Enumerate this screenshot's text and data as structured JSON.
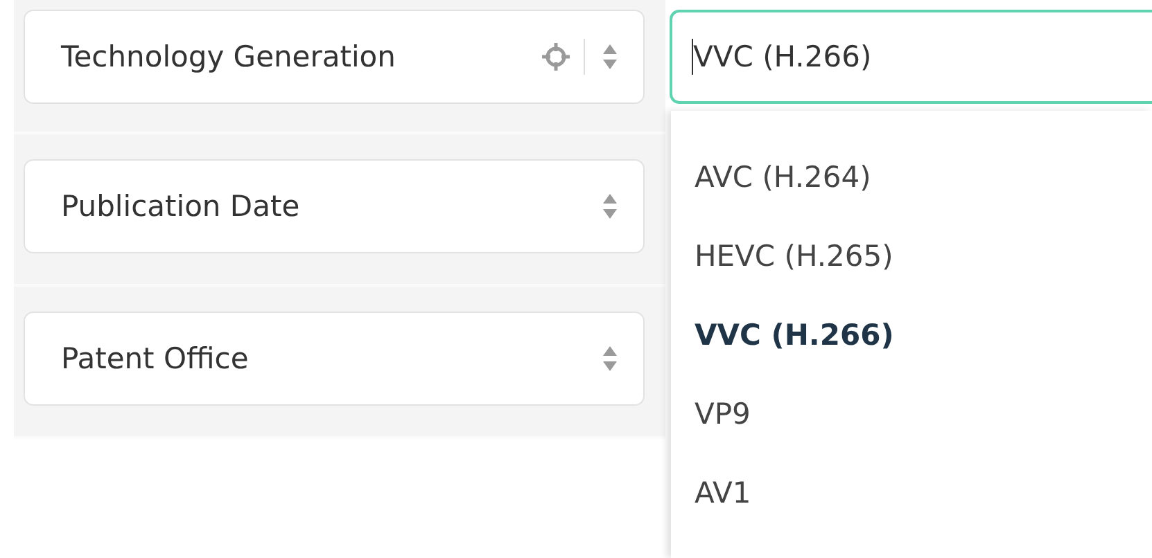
{
  "fields": [
    {
      "label": "Technology Generation",
      "locate_button": true
    },
    {
      "label": "Publication Date",
      "locate_button": false
    },
    {
      "label": "Patent Office",
      "locate_button": false
    }
  ],
  "value_input": {
    "value": "VVC (H.266)",
    "focused": true
  },
  "options": [
    {
      "label": "AVC (H.264)",
      "selected": false
    },
    {
      "label": "HEVC (H.265)",
      "selected": false
    },
    {
      "label": "VVC (H.266)",
      "selected": true
    },
    {
      "label": "VP9",
      "selected": false
    },
    {
      "label": "AV1",
      "selected": false
    }
  ]
}
